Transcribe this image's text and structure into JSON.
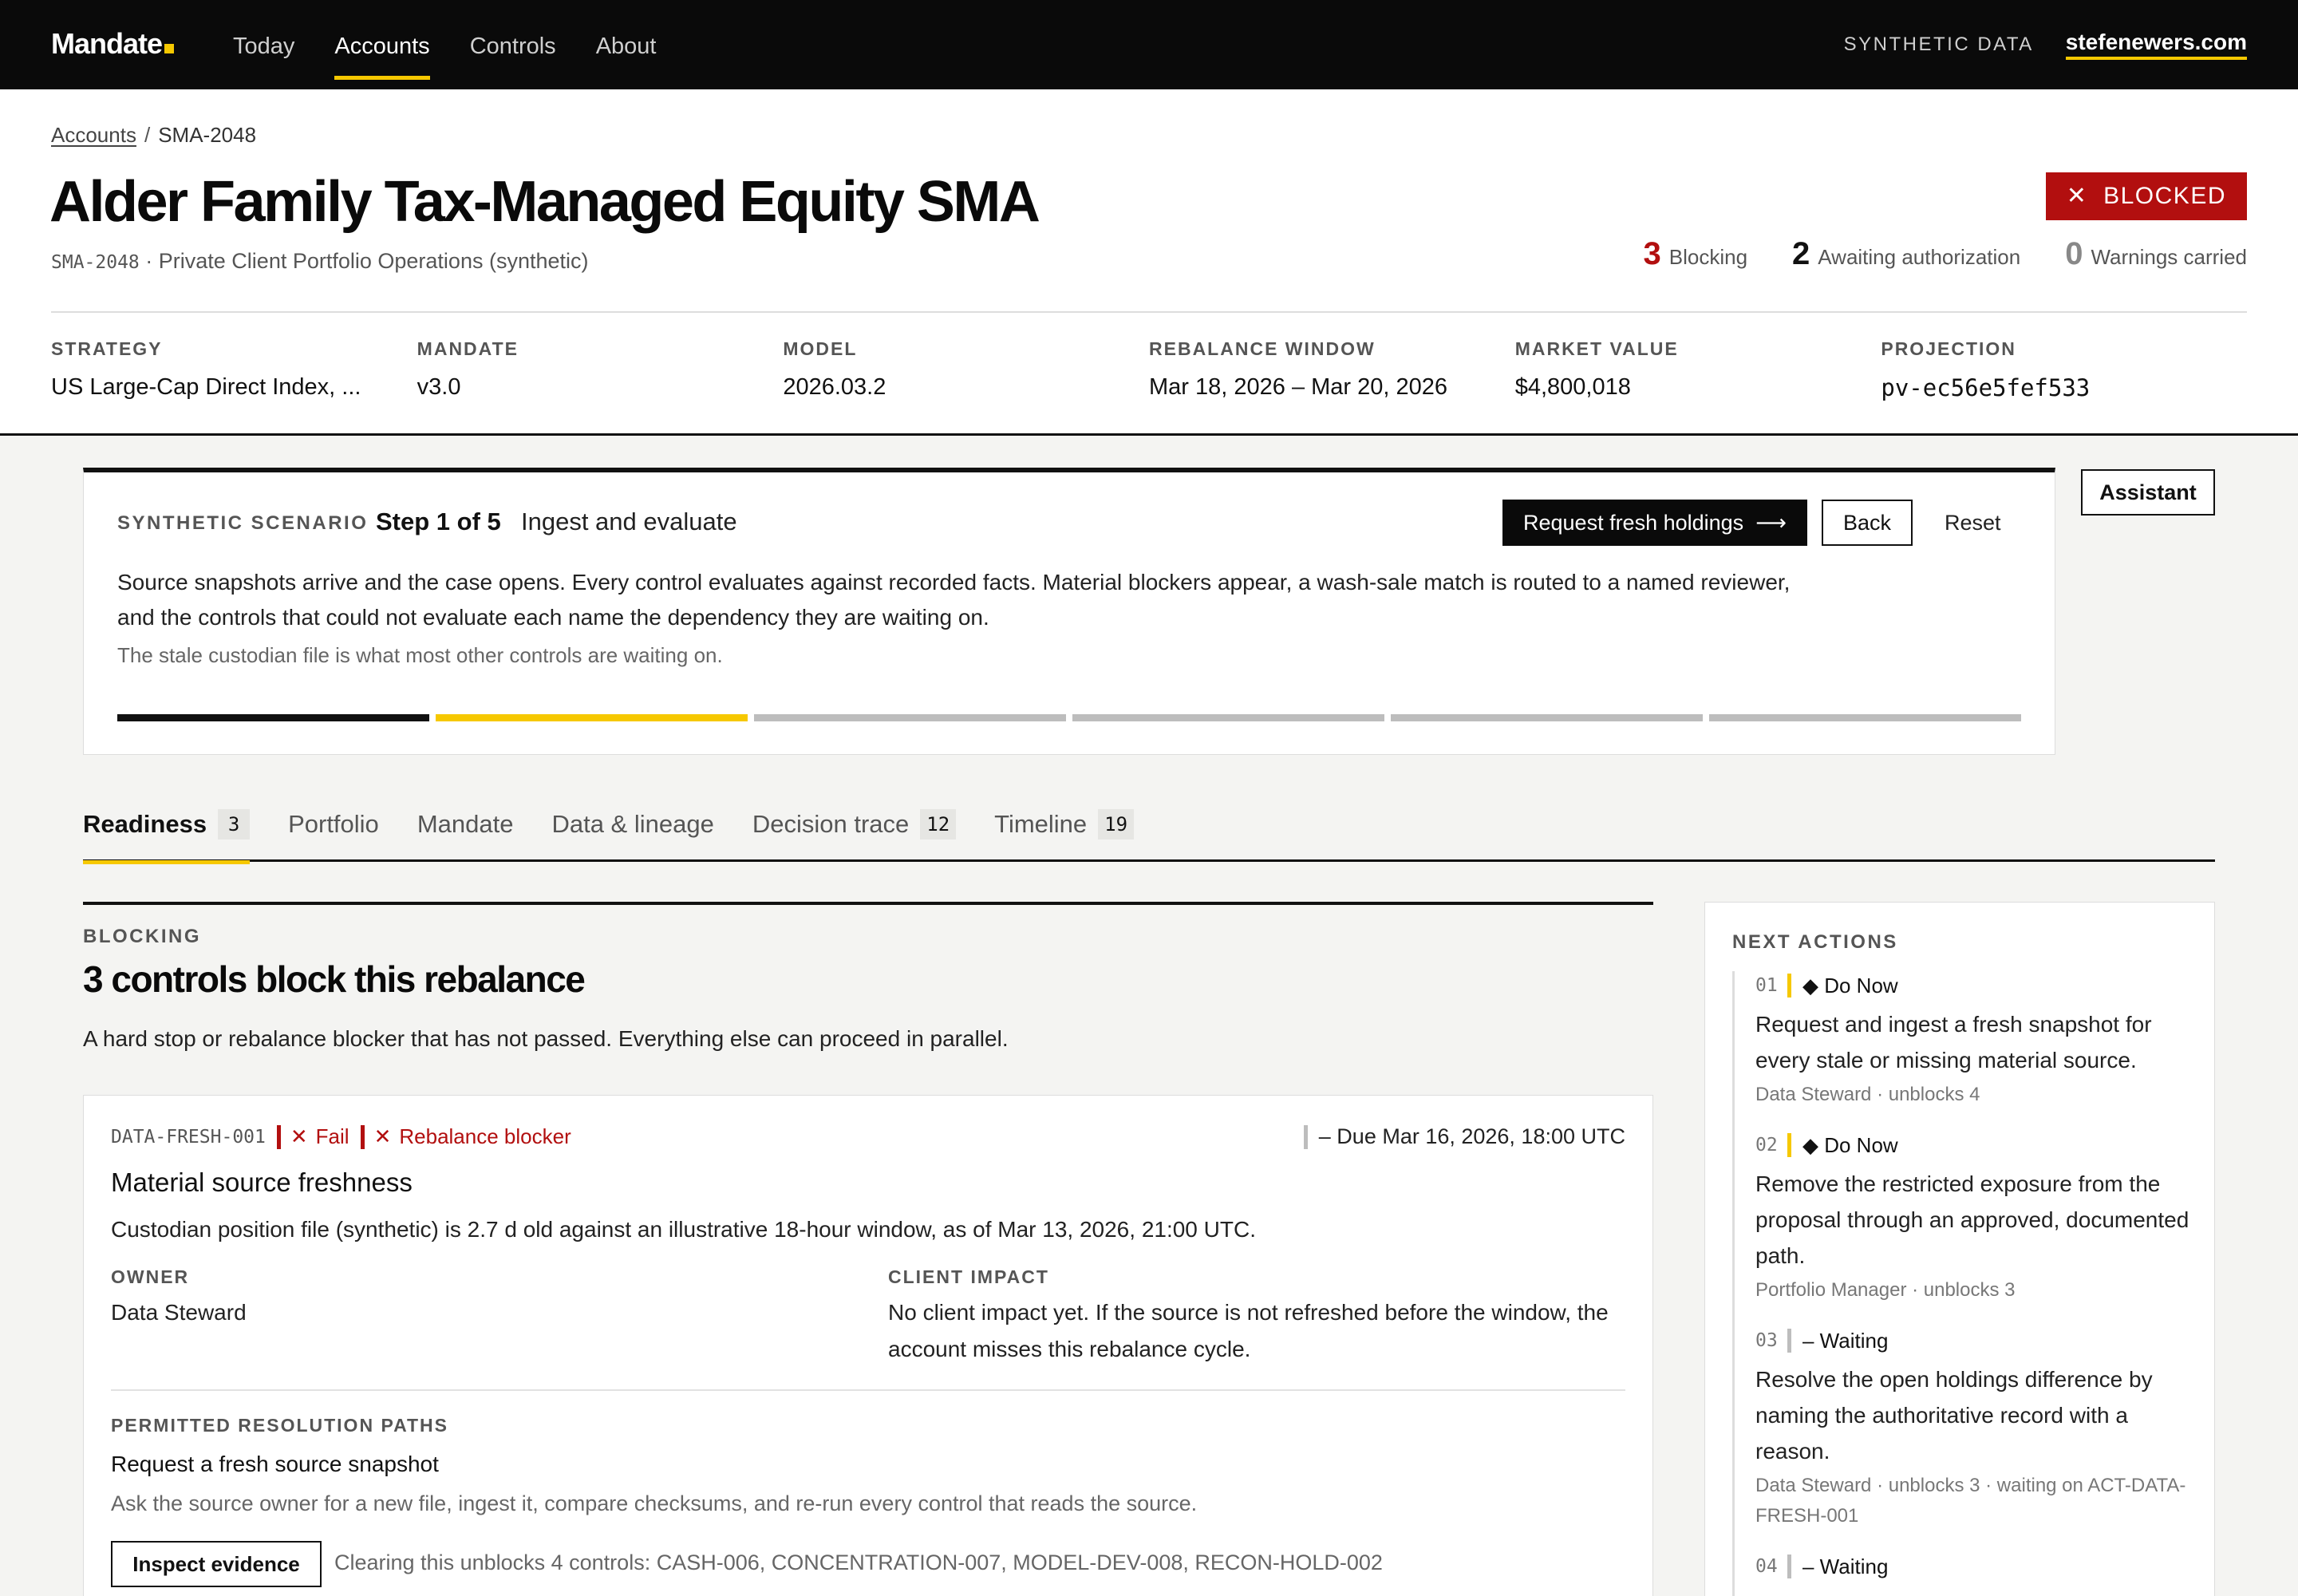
{
  "nav": {
    "brand": "Mandate",
    "links": [
      "Today",
      "Accounts",
      "Controls",
      "About"
    ],
    "active_index": 1,
    "synthetic_tag": "SYNTHETIC DATA",
    "site_link": "stefenewers.com",
    "accent_color": "#f6c800"
  },
  "header": {
    "breadcrumb_link": "Accounts",
    "breadcrumb_sep": "/",
    "breadcrumb_current": "SMA-2048",
    "title": "Alder Family Tax-Managed Equity SMA",
    "subtitle_code": "SMA-2048",
    "subtitle_text": " · Private Client Portfolio Operations (synthetic)",
    "status_badge": "BLOCKED",
    "status_color": "#b20f0f",
    "counts": [
      {
        "num": "3",
        "label": "Blocking"
      },
      {
        "num": "2",
        "label": "Awaiting authorization"
      },
      {
        "num": "0",
        "label": "Warnings carried"
      }
    ],
    "meta": [
      {
        "label": "STRATEGY",
        "value": "US Large-Cap Direct Index, ..."
      },
      {
        "label": "MANDATE",
        "value": "v3.0"
      },
      {
        "label": "MODEL",
        "value": "2026.03.2"
      },
      {
        "label": "REBALANCE WINDOW",
        "value": "Mar 18, 2026 – Mar 20, 2026"
      },
      {
        "label": "MARKET VALUE",
        "value": "$4,800,018"
      },
      {
        "label": "PROJECTION",
        "value": "pv-ec56e5fef533"
      }
    ]
  },
  "scenario": {
    "label": "SYNTHETIC SCENARIO",
    "step": "Step 1 of 5",
    "step_name": "Ingest and evaluate",
    "primary_button": "Request fresh holdings",
    "back_button": "Back",
    "reset_button": "Reset",
    "body": "Source snapshots arrive and the case opens. Every control evaluates against recorded facts. Material blockers appear, a wash-sale match is routed to a named reviewer, and the controls that could not evaluate each name the dependency they are waiting on.",
    "note": "The stale custodian file is what most other controls are waiting on.",
    "progress_total": 6,
    "progress_done": 1,
    "progress_current": 2
  },
  "assistant_button": "Assistant",
  "tabs": [
    {
      "label": "Readiness",
      "badge": "3"
    },
    {
      "label": "Portfolio",
      "badge": ""
    },
    {
      "label": "Mandate",
      "badge": ""
    },
    {
      "label": "Data & lineage",
      "badge": ""
    },
    {
      "label": "Decision trace",
      "badge": "12"
    },
    {
      "label": "Timeline",
      "badge": "19"
    }
  ],
  "section": {
    "eyebrow": "BLOCKING",
    "title": "3 controls block this rebalance",
    "description": "A hard stop or rebalance blocker that has not passed. Everything else can proceed in parallel."
  },
  "card": {
    "code": "DATA-FRESH-001",
    "flag_fail": "Fail",
    "flag_blocker": "Rebalance blocker",
    "due": "– Due Mar 16, 2026, 18:00 UTC",
    "title": "Material source freshness",
    "description": "Custodian position file (synthetic) is 2.7 d old against an illustrative 18-hour window, as of Mar 13, 2026, 21:00 UTC.",
    "owner_label": "OWNER",
    "owner_value": "Data Steward",
    "impact_label": "CLIENT IMPACT",
    "impact_value": "No client impact yet. If the source is not refreshed before the window, the account misses this rebalance cycle.",
    "paths_label": "PERMITTED RESOLUTION PATHS",
    "path_title": "Request a fresh source snapshot",
    "path_desc": "Ask the source owner for a new file, ingest it, compare checksums, and re-run every control that reads the source.",
    "inspect_button": "Inspect evidence",
    "unblocks": "Clearing this unblocks 4 controls: CASH-006, CONCENTRATION-007, MODEL-DEV-008, RECON-HOLD-002"
  },
  "next_actions": {
    "label": "NEXT ACTIONS",
    "items": [
      {
        "num": "01",
        "bar": "yellow",
        "state": "◆ Do Now",
        "body": "Request and ingest a fresh snapshot for every stale or missing material source.",
        "meta": "Data Steward · unblocks 4"
      },
      {
        "num": "02",
        "bar": "yellow",
        "state": "◆ Do Now",
        "body": "Remove the restricted exposure from the proposal through an approved, documented path.",
        "meta": "Portfolio Manager · unblocks 3"
      },
      {
        "num": "03",
        "bar": "grey",
        "state": "– Waiting",
        "body": "Resolve the open holdings difference by naming the authoritative record with a reason.",
        "meta": "Data Steward · unblocks 3 · waiting on ACT-DATA-FRESH-001"
      },
      {
        "num": "04",
        "bar": "grey",
        "state": "– Waiting",
        "body": "",
        "meta": ""
      }
    ]
  }
}
